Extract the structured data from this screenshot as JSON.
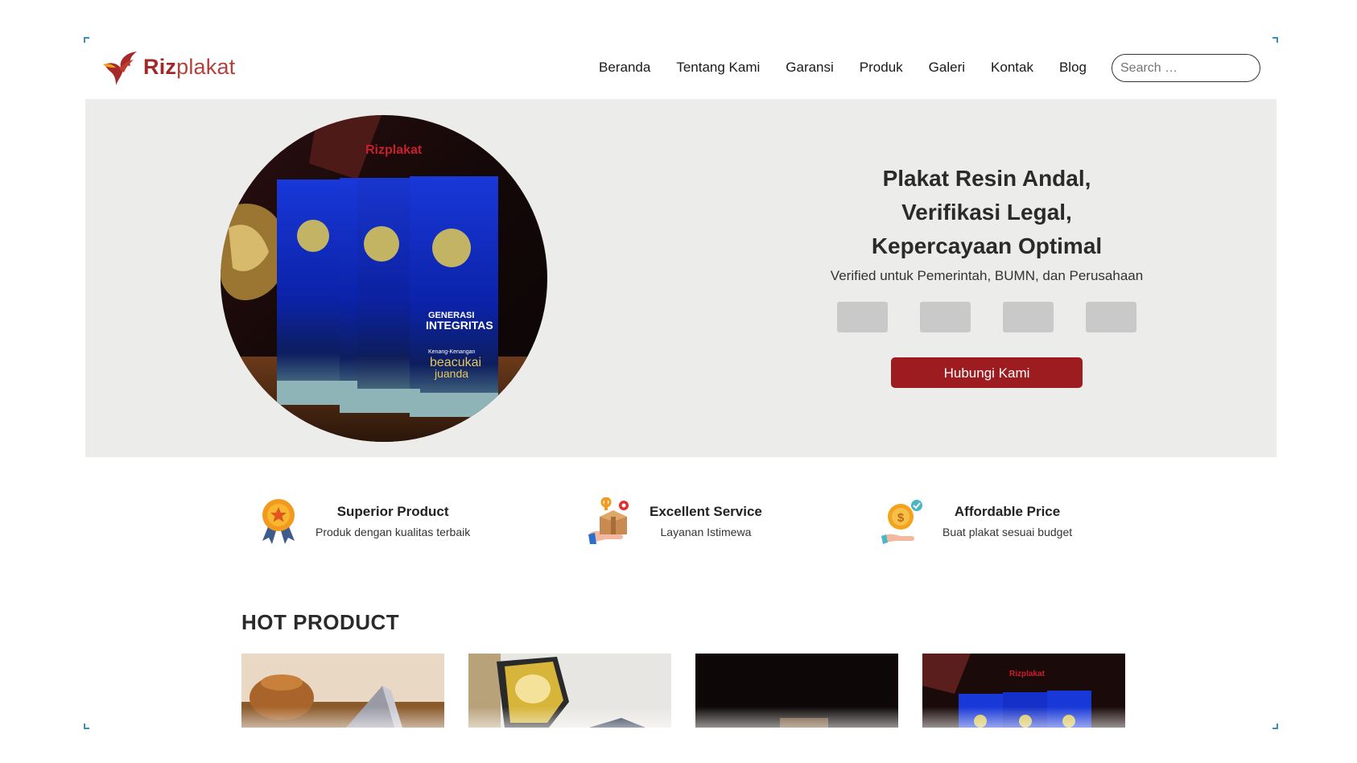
{
  "brand": {
    "logo_bold": "Riz",
    "logo_light": "plakat",
    "accent": "#9c1c20"
  },
  "nav": {
    "items": [
      "Beranda",
      "Tentang Kami",
      "Garansi",
      "Produk",
      "Galeri",
      "Kontak",
      "Blog"
    ],
    "search_placeholder": "Search …"
  },
  "hero": {
    "title_lines": [
      "Plakat Resin Andal,",
      "Verifikasi Legal,",
      "Kepercayaan Optimal"
    ],
    "subtitle": "Verified untuk Pemerintah, BUMN, dan Perusahaan",
    "cta": "Hubungi Kami",
    "image": {
      "watermark": "Rizplakat",
      "trophy_line1": "GENERASI",
      "trophy_line2": "INTEGRITAS",
      "trophy_caption": "Kenang-Kenangan",
      "trophy_brand1": "beacukai",
      "trophy_brand2": "juanda"
    }
  },
  "features": [
    {
      "title": "Superior Product",
      "desc": "Produk dengan kualitas terbaik",
      "icon": "medal-icon"
    },
    {
      "title": "Excellent Service",
      "desc": "Layanan Istimewa",
      "icon": "service-box-icon"
    },
    {
      "title": "Affordable Price",
      "desc": "Buat plakat sesuai budget",
      "icon": "coin-hand-icon"
    }
  ],
  "hot_product": {
    "title": "HOT PRODUCT",
    "card4_watermark": "Rizplakat"
  }
}
